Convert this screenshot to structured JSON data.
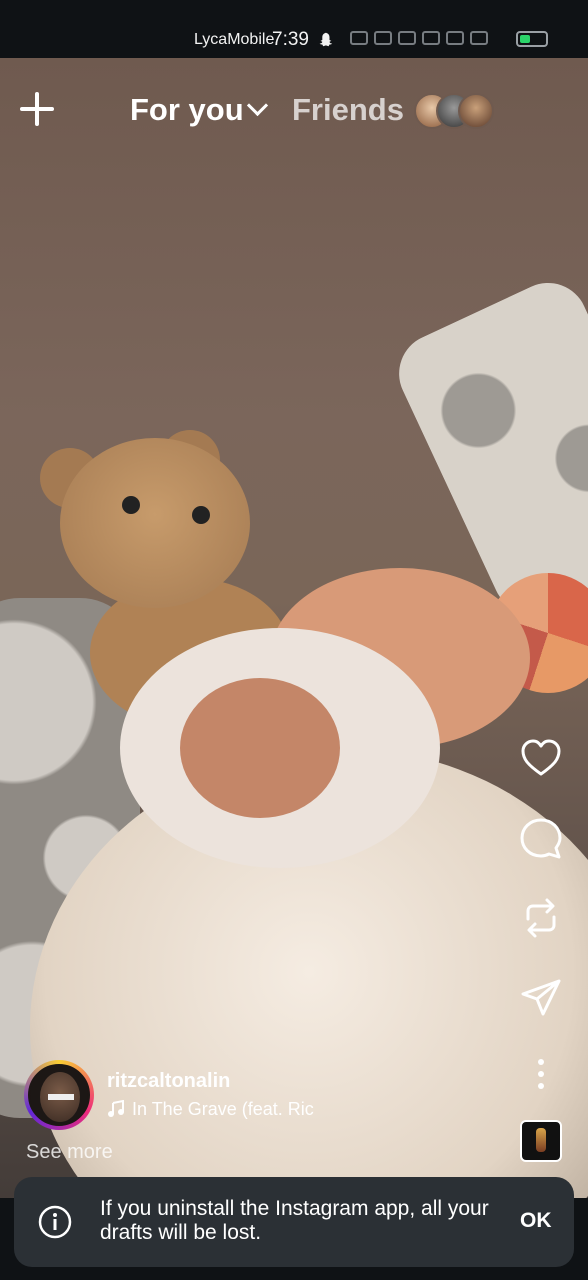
{
  "status_bar": {
    "carrier": "LycaMobile",
    "time": "7:39"
  },
  "top_nav": {
    "tab_for_you": "For you",
    "tab_friends": "Friends"
  },
  "post": {
    "username": "ritzcaltonalin",
    "song": "In The Grave (feat. Ric",
    "see_more": "See more"
  },
  "toast": {
    "message": "If you uninstall the Instagram app, all your drafts will be lost.",
    "action": "OK"
  },
  "colors": {
    "toast_bg": "#2b3035",
    "status_bg": "#0f1215",
    "story_ring": "#ee2a7b"
  }
}
